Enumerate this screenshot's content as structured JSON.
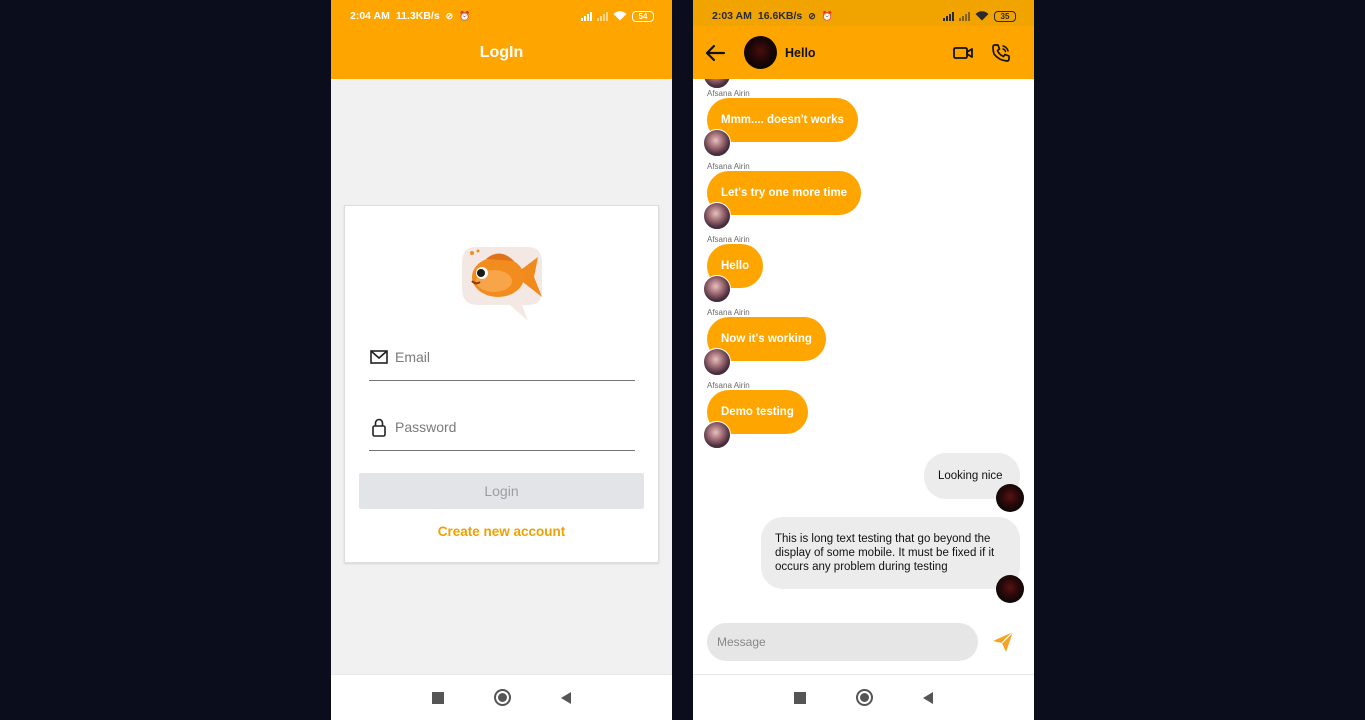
{
  "login_screen": {
    "status": {
      "time": "2:04 AM",
      "speed": "11.3KB/s",
      "battery": "54"
    },
    "title": "LogIn",
    "logo": "goldfish-chat-bubble-logo",
    "email_placeholder": "Email",
    "password_placeholder": "Password",
    "login_label": "Login",
    "create_account_label": "Create new account"
  },
  "chat_screen": {
    "status": {
      "time": "2:03 AM",
      "speed": "16.6KB/s",
      "battery": "35"
    },
    "header_name": "Hello",
    "incoming": [
      {
        "sender": "Afsana Airin",
        "text": "Mmm.... doesn't works"
      },
      {
        "sender": "Afsana Airin",
        "text": "Let's try one more time"
      },
      {
        "sender": "Afsana Airin",
        "text": "Hello"
      },
      {
        "sender": "Afsana Airin",
        "text": "Now it's working"
      },
      {
        "sender": "Afsana Airin",
        "text": "Demo testing"
      }
    ],
    "outgoing": [
      {
        "text": "Looking nice"
      },
      {
        "text": "This is long text testing that go beyond the display of some mobile. It must be fixed if it occurs any problem during testing"
      }
    ],
    "message_placeholder": "Message"
  },
  "colors": {
    "accent": "#ffa500",
    "link": "#f0a000",
    "background": "#0b0d1c",
    "outgoing_bubble": "#ececec"
  },
  "icons": [
    "mail-icon",
    "lock-icon",
    "back-arrow-icon",
    "video-call-icon",
    "phone-call-icon",
    "send-icon",
    "wifi-icon",
    "signal-icon",
    "alarm-icon"
  ]
}
